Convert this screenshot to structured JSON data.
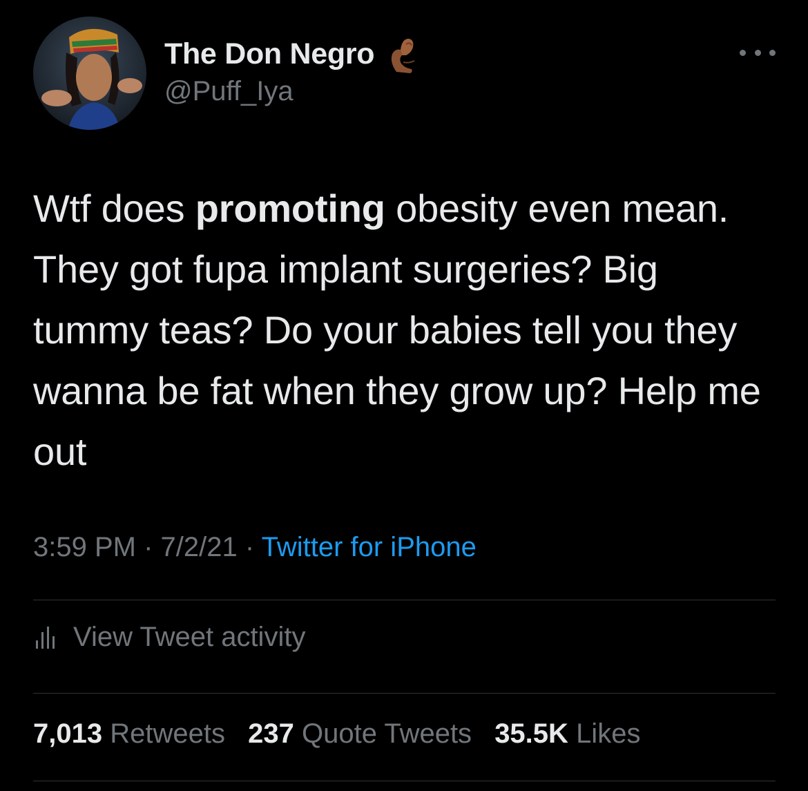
{
  "author": {
    "display_name": "The Don Negro",
    "name_emoji": "pinched-fingers-emoji",
    "handle": "@Puff_Iya",
    "avatar": "profile-photo"
  },
  "tweet": {
    "text_before": "Wtf does ",
    "text_bold": "promoting",
    "text_after": " obesity even mean. They got fupa implant surgeries? Big tummy teas? Do your babies tell you they wanna be fat when they grow up? Help me out",
    "time": "3:59 PM",
    "separator": "·",
    "date": "7/2/21",
    "source": "Twitter for iPhone"
  },
  "activity": {
    "icon": "bar-chart-icon",
    "label": "View Tweet activity"
  },
  "stats": {
    "retweets_count": "7,013",
    "retweets_label": "Retweets",
    "quotes_count": "237",
    "quotes_label": "Quote Tweets",
    "likes_count": "35.5K",
    "likes_label": "Likes"
  },
  "colors": {
    "background": "#000000",
    "text_primary": "#e7e9ea",
    "text_secondary": "#71767b",
    "link": "#1d9bf0",
    "divider": "#2f3336"
  }
}
